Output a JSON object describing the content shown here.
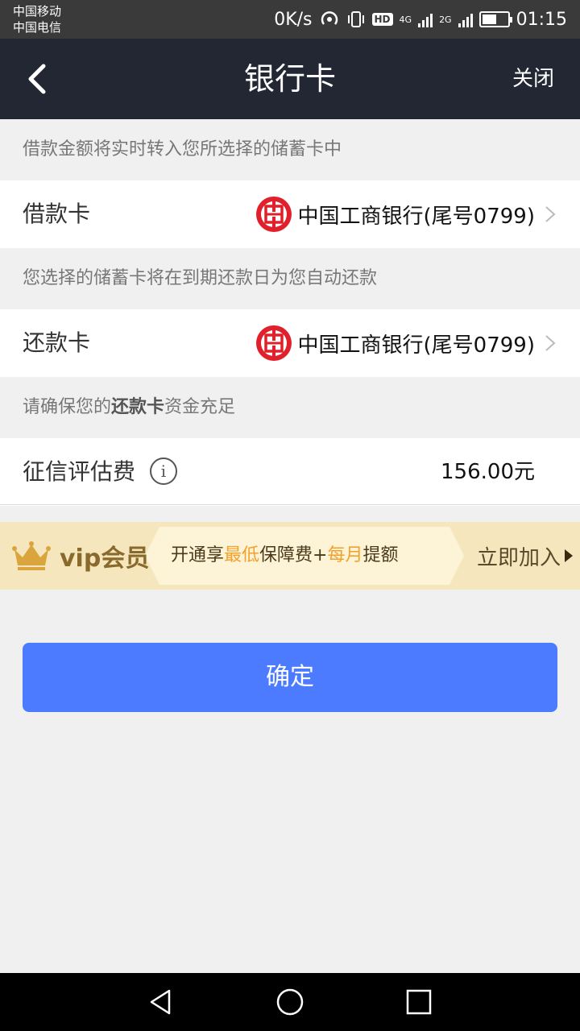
{
  "status_bar": {
    "carrier1": "中国移动",
    "carrier2": "中国电信",
    "net_speed": "0K/s",
    "hd": "HD",
    "net1": "4G",
    "net2": "2G",
    "time": "01:15",
    "battery_level": 0.55
  },
  "navbar": {
    "title": "银行卡",
    "close_label": "关闭"
  },
  "borrow": {
    "hint": "借款金额将实时转入您所选择的储蓄卡中",
    "label": "借款卡",
    "bank": "中国工商银行(尾号0799)"
  },
  "repay": {
    "hint": "您选择的储蓄卡将在到期还款日为您自动还款",
    "label": "还款卡",
    "bank": "中国工商银行(尾号0799)"
  },
  "ensure_hint": {
    "prefix": "请确保您的",
    "bold": "还款卡",
    "suffix": "资金充足"
  },
  "fee": {
    "label": "征信评估费",
    "info": "i",
    "value": "156.00元"
  },
  "vip": {
    "title": "vip会员",
    "desc_1": "开通享",
    "desc_hl1": "最低",
    "desc_2": "保障费+",
    "desc_hl2": "每月",
    "desc_3": "提额",
    "join": "立即加入"
  },
  "confirm_label": "确定",
  "colors": {
    "accent": "#4c7bff",
    "navbar": "#222733",
    "bank_red": "#e0202a",
    "vip_gold": "#f3a12a"
  },
  "icons": [
    "back-arrow-icon",
    "icbc-logo-icon",
    "chevron-right-icon",
    "info-icon",
    "crown-icon",
    "triangle-right-icon",
    "nav-back-icon",
    "nav-home-icon",
    "nav-recent-icon"
  ]
}
